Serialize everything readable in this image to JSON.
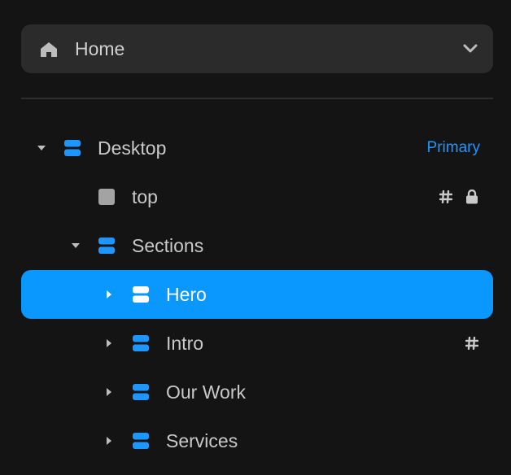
{
  "page_selector": {
    "label": "Home",
    "icon": "home-icon",
    "dropdown_icon": "chevron-down-icon"
  },
  "tree": [
    {
      "label": "Desktop",
      "badge": "Primary",
      "icon": "stack-icon",
      "expanded": true
    },
    {
      "label": "top",
      "icon": "square-icon",
      "markers": [
        "hash-icon",
        "lock-icon"
      ]
    },
    {
      "label": "Sections",
      "icon": "stack-icon",
      "expanded": true
    },
    {
      "label": "Hero",
      "icon": "stack-icon",
      "expanded": false,
      "selected": true
    },
    {
      "label": "Intro",
      "icon": "stack-icon",
      "expanded": false,
      "markers": [
        "hash-icon"
      ]
    },
    {
      "label": "Our Work",
      "icon": "stack-icon",
      "expanded": false
    },
    {
      "label": "Services",
      "icon": "stack-icon",
      "expanded": false
    }
  ],
  "colors": {
    "accent": "#0a98ff",
    "stack_icon": "#1e96ff",
    "background": "#141414",
    "selector_bg": "#2b2b2b"
  }
}
